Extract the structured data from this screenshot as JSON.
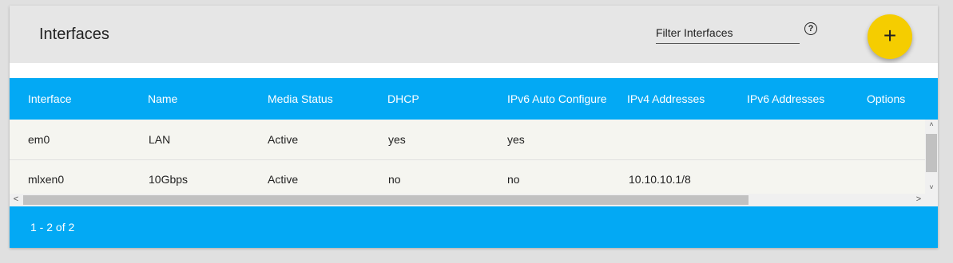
{
  "header": {
    "title": "Interfaces",
    "filter_placeholder": "Filter Interfaces",
    "help_icon": "?",
    "add_icon": "+"
  },
  "table": {
    "columns": [
      "Interface",
      "Name",
      "Media Status",
      "DHCP",
      "IPv6 Auto Configure",
      "IPv4 Addresses",
      "IPv6 Addresses",
      "Options"
    ],
    "rows": [
      [
        "em0",
        "LAN",
        "Active",
        "yes",
        "yes",
        "",
        "",
        ""
      ],
      [
        "mlxen0",
        "10Gbps",
        "Active",
        "no",
        "no",
        "10.10.10.1/8",
        "",
        ""
      ]
    ]
  },
  "scrollbar": {
    "up": "˄",
    "down": "˅",
    "left": "<",
    "right": ">"
  },
  "footer": {
    "pager": "1 - 2 of 2"
  },
  "colors": {
    "accent": "#03a9f4",
    "fab": "#f5cd00"
  }
}
